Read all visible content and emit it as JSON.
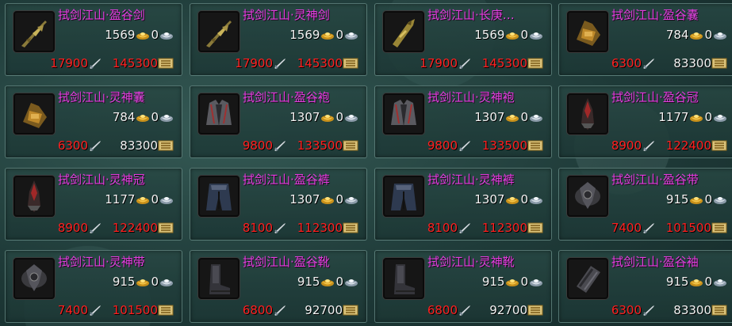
{
  "items": [
    {
      "name": "拭剑江山·盈谷剑",
      "gold": "1569",
      "silver": "0",
      "cost1": "17900",
      "cost2": "145300",
      "cost2_color": "red",
      "icon": "sword-item-icon"
    },
    {
      "name": "拭剑江山·灵神剑",
      "gold": "1569",
      "silver": "0",
      "cost1": "17900",
      "cost2": "145300",
      "cost2_color": "red",
      "icon": "sword-item-icon"
    },
    {
      "name": "拭剑江山·长庚…",
      "gold": "1569",
      "silver": "0",
      "cost1": "17900",
      "cost2": "145300",
      "cost2_color": "red",
      "icon": "blade-item-icon"
    },
    {
      "name": "拭剑江山·盈谷囊",
      "gold": "784",
      "silver": "0",
      "cost1": "6300",
      "cost2": "83300",
      "cost2_color": "white",
      "icon": "pouch-item-icon"
    },
    {
      "name": "拭剑江山·灵神囊",
      "gold": "784",
      "silver": "0",
      "cost1": "6300",
      "cost2": "83300",
      "cost2_color": "white",
      "icon": "pouch-item-icon"
    },
    {
      "name": "拭剑江山·盈谷袍",
      "gold": "1307",
      "silver": "0",
      "cost1": "9800",
      "cost2": "133500",
      "cost2_color": "red",
      "icon": "robe-item-icon"
    },
    {
      "name": "拭剑江山·灵神袍",
      "gold": "1307",
      "silver": "0",
      "cost1": "9800",
      "cost2": "133500",
      "cost2_color": "red",
      "icon": "robe-item-icon"
    },
    {
      "name": "拭剑江山·盈谷冠",
      "gold": "1177",
      "silver": "0",
      "cost1": "8900",
      "cost2": "122400",
      "cost2_color": "red",
      "icon": "crown-item-icon"
    },
    {
      "name": "拭剑江山·灵神冠",
      "gold": "1177",
      "silver": "0",
      "cost1": "8900",
      "cost2": "122400",
      "cost2_color": "red",
      "icon": "crown-item-icon"
    },
    {
      "name": "拭剑江山·盈谷裤",
      "gold": "1307",
      "silver": "0",
      "cost1": "8100",
      "cost2": "112300",
      "cost2_color": "red",
      "icon": "pants-item-icon"
    },
    {
      "name": "拭剑江山·灵神裤",
      "gold": "1307",
      "silver": "0",
      "cost1": "8100",
      "cost2": "112300",
      "cost2_color": "red",
      "icon": "pants-item-icon"
    },
    {
      "name": "拭剑江山·盈谷带",
      "gold": "915",
      "silver": "0",
      "cost1": "7400",
      "cost2": "101500",
      "cost2_color": "red",
      "icon": "belt-item-icon"
    },
    {
      "name": "拭剑江山·灵神带",
      "gold": "915",
      "silver": "0",
      "cost1": "7400",
      "cost2": "101500",
      "cost2_color": "red",
      "icon": "belt-item-icon"
    },
    {
      "name": "拭剑江山·盈谷靴",
      "gold": "915",
      "silver": "0",
      "cost1": "6800",
      "cost2": "92700",
      "cost2_color": "white",
      "icon": "boots-item-icon"
    },
    {
      "name": "拭剑江山·灵神靴",
      "gold": "915",
      "silver": "0",
      "cost1": "6800",
      "cost2": "92700",
      "cost2_color": "white",
      "icon": "boots-item-icon"
    },
    {
      "name": "拭剑江山·盈谷袖",
      "gold": "915",
      "silver": "0",
      "cost1": "6300",
      "cost2": "83300",
      "cost2_color": "white",
      "icon": "sleeve-item-icon"
    }
  ],
  "colors": {
    "name": "#e43ee0",
    "cost_red": "#ff2020",
    "text": "#f2f2f2"
  }
}
